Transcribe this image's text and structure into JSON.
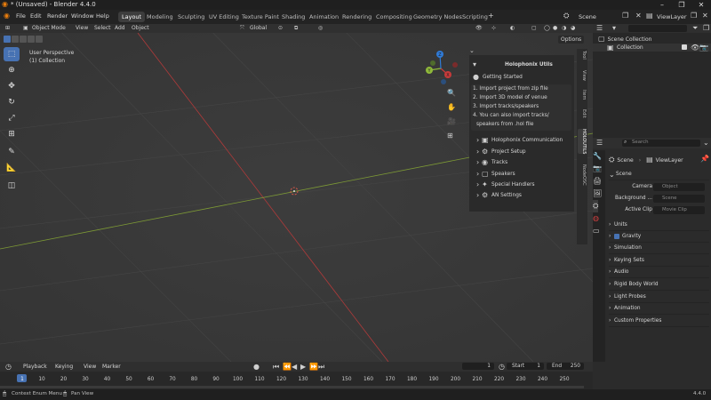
{
  "window": {
    "title": "* (Unsaved) - Blender 4.4.0"
  },
  "menu": [
    "File",
    "Edit",
    "Render",
    "Window",
    "Help"
  ],
  "workspaces": [
    "Layout",
    "Modeling",
    "Sculpting",
    "UV Editing",
    "Texture Paint",
    "Shading",
    "Animation",
    "Rendering",
    "Compositing",
    "Geometry Nodes",
    "Scripting"
  ],
  "active_workspace": "Layout",
  "scene": {
    "name": "Scene",
    "view_layer": "ViewLayer"
  },
  "viewport": {
    "mode": "Object Mode",
    "menus": [
      "View",
      "Select",
      "Add",
      "Object"
    ],
    "transform": "Global",
    "overlay_title": "User Perspective",
    "overlay_sub": "(1) Collection",
    "options_label": "Options",
    "gizmo": {
      "x": "X",
      "y": "Y",
      "z": "Z"
    }
  },
  "npanel": {
    "title": "Holophonix Utils",
    "getting_started": "Getting Started",
    "steps": [
      "1. Import project from zip file",
      "2. Import 3D model of venue",
      "3. Import tracks/speakers",
      "4. You can also import tracks/",
      "speakers from .hol file"
    ],
    "sections": [
      "Holophonix Communication",
      "Project Setup",
      "Tracks",
      "Speakers",
      "Special Handlers",
      "AN Settings"
    ],
    "tabs": [
      "Tool",
      "View",
      "Item",
      "Edit",
      "HOLOUTILS",
      "NodeOSC"
    ]
  },
  "outliner": {
    "root": "Scene Collection",
    "child": "Collection"
  },
  "properties": {
    "search_placeholder": "Search",
    "breadcrumb": [
      "Scene",
      "ViewLayer"
    ],
    "panel": "Scene",
    "fields": [
      {
        "label": "Camera",
        "placeholder": "Object"
      },
      {
        "label": "Background ...",
        "placeholder": "Scene"
      },
      {
        "label": "Active Clip",
        "placeholder": "Movie Clip"
      }
    ],
    "sections": [
      "Units",
      "Gravity",
      "Simulation",
      "Keying Sets",
      "Audio",
      "Rigid Body World",
      "Light Probes",
      "Animation",
      "Custom Properties"
    ]
  },
  "timeline": {
    "menus": [
      "Playback",
      "Keying",
      "View",
      "Marker"
    ],
    "current_frame": "1",
    "start_label": "Start",
    "start": "1",
    "end_label": "End",
    "end": "250",
    "ticks": [
      "1",
      "10",
      "20",
      "30",
      "40",
      "50",
      "60",
      "70",
      "80",
      "90",
      "100",
      "110",
      "120",
      "130",
      "140",
      "150",
      "160",
      "170",
      "180",
      "190",
      "200",
      "210",
      "220",
      "230",
      "240",
      "250"
    ]
  },
  "statusbar": {
    "left1": "Context Enum Menu",
    "left2": "Pan View",
    "version": "4.4.0"
  },
  "colors": {
    "accent": "#4772b3",
    "x_axis": "#c83a3a",
    "y_axis": "#8fb93a",
    "z_axis": "#2f7ad6"
  }
}
